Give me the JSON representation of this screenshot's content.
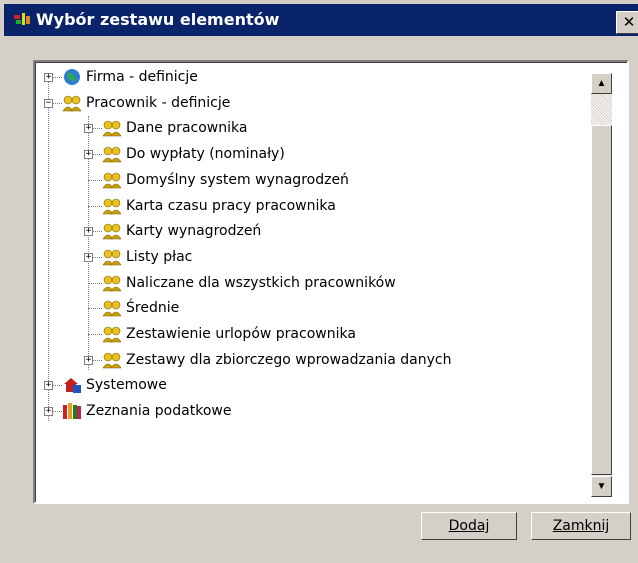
{
  "window": {
    "title": "Wybór zestawu elementów",
    "close_label": "✕"
  },
  "tree": {
    "nodes": [
      {
        "label": "Firma - definicje",
        "icon": "globe-icon",
        "expander": "+"
      },
      {
        "label": "Pracownik - definicje",
        "icon": "people-icon",
        "expander": "−"
      },
      {
        "label": "Dane pracownika",
        "icon": "people-icon",
        "expander": "+"
      },
      {
        "label": "Do wypłaty (nominały)",
        "icon": "people-icon",
        "expander": "+"
      },
      {
        "label": "Domyślny system wynagrodzeń",
        "icon": "people-icon",
        "expander": ""
      },
      {
        "label": "Karta czasu pracy pracownika",
        "icon": "people-icon",
        "expander": ""
      },
      {
        "label": "Karty wynagrodzeń",
        "icon": "people-icon",
        "expander": "+"
      },
      {
        "label": "Listy płac",
        "icon": "people-icon",
        "expander": "+"
      },
      {
        "label": "Naliczane dla wszystkich pracowników",
        "icon": "people-icon",
        "expander": ""
      },
      {
        "label": "Średnie",
        "icon": "people-icon",
        "expander": ""
      },
      {
        "label": "Zestawienie urlopów pracownika",
        "icon": "people-icon",
        "expander": ""
      },
      {
        "label": "Zestawy dla zbiorczego wprowadzania danych",
        "icon": "people-icon",
        "expander": "+"
      },
      {
        "label": "Systemowe",
        "icon": "system-icon",
        "expander": "+"
      },
      {
        "label": "Zeznania podatkowe",
        "icon": "books-icon",
        "expander": "+"
      }
    ]
  },
  "scrollbar": {
    "up_glyph": "▲",
    "down_glyph": "▼"
  },
  "buttons": {
    "add_label": "Dodaj",
    "close_label": "Zamknij"
  },
  "colors": {
    "titlebar": "#0a246a",
    "face": "#d4d0c8",
    "tree_bg": "#ffffff"
  }
}
